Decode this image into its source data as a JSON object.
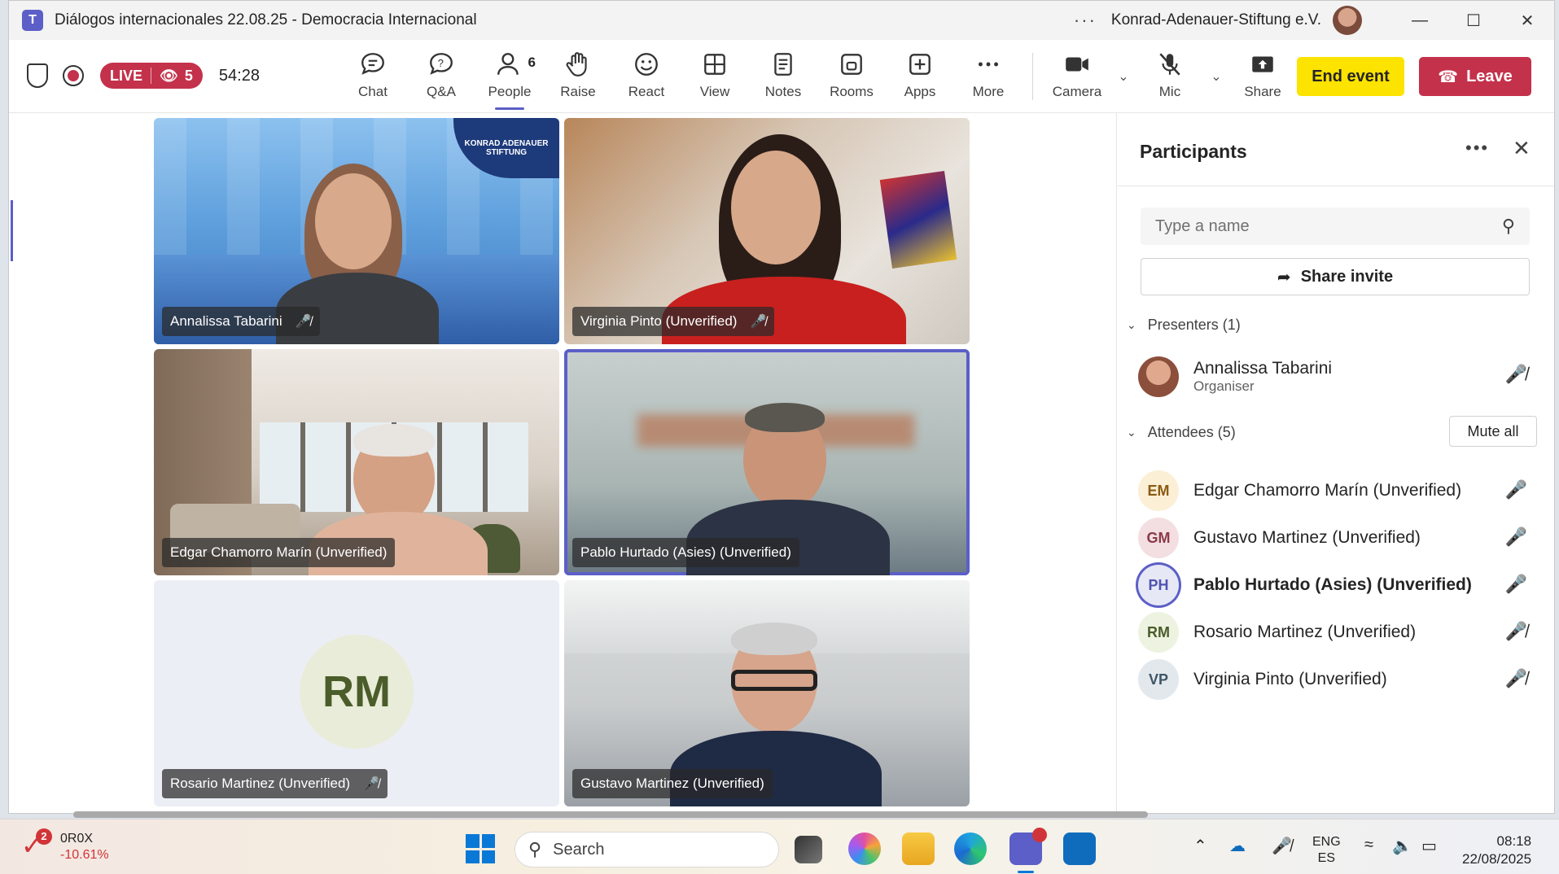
{
  "window": {
    "title": "Diálogos internacionales 22.08.25 - Democracia Internacional",
    "org": "Konrad-Adenauer-Stiftung e.V.",
    "more_label": "···"
  },
  "toolbar": {
    "live_label": "LIVE",
    "viewers": "5",
    "timer": "54:28",
    "tools": [
      {
        "key": "chat",
        "label": "Chat"
      },
      {
        "key": "qa",
        "label": "Q&A"
      },
      {
        "key": "people",
        "label": "People",
        "count": "6"
      },
      {
        "key": "raise",
        "label": "Raise"
      },
      {
        "key": "react",
        "label": "React"
      },
      {
        "key": "view",
        "label": "View"
      },
      {
        "key": "notes",
        "label": "Notes"
      },
      {
        "key": "rooms",
        "label": "Rooms"
      },
      {
        "key": "apps",
        "label": "Apps"
      },
      {
        "key": "more",
        "label": "More"
      }
    ],
    "camera_label": "Camera",
    "mic_label": "Mic",
    "share_label": "Share",
    "end_event_label": "End event",
    "leave_label": "Leave"
  },
  "video_tiles": [
    {
      "name": "Annalissa Tabarini",
      "muted": true
    },
    {
      "name": "Virginia Pinto (Unverified)",
      "muted": true
    },
    {
      "name": "Edgar Chamorro Marín (Unverified)",
      "muted": false
    },
    {
      "name": "Pablo Hurtado (Asies) (Unverified)",
      "muted": false,
      "speaking": true
    },
    {
      "name": "Rosario Martinez (Unverified)",
      "muted": true,
      "initials": "RM"
    },
    {
      "name": "Gustavo Martinez (Unverified)",
      "muted": false
    }
  ],
  "kas_logo": "KONRAD ADENAUER STIFTUNG",
  "panel": {
    "title": "Participants",
    "search_placeholder": "Type a name",
    "share_invite_label": "Share invite",
    "presenters_label": "Presenters (1)",
    "attendees_label": "Attendees (5)",
    "mute_all_label": "Mute all",
    "presenter": {
      "name": "Annalissa Tabarini",
      "role": "Organiser",
      "muted": true
    },
    "attendees": [
      {
        "initials": "EM",
        "name": "Edgar Chamorro Marín (Unverified)",
        "muted": false,
        "avatar_bg": "#fbefd6",
        "avatar_fg": "#8a5b12"
      },
      {
        "initials": "GM",
        "name": "Gustavo Martinez (Unverified)",
        "muted": false,
        "avatar_bg": "#f3dfe2",
        "avatar_fg": "#8a3a48"
      },
      {
        "initials": "PH",
        "name": "Pablo Hurtado (Asies) (Unverified)",
        "muted": false,
        "speaking": true,
        "avatar_bg": "#e6e8f5",
        "avatar_fg": "#4f52b2"
      },
      {
        "initials": "RM",
        "name": "Rosario Martinez (Unverified)",
        "muted": true,
        "avatar_bg": "#eef2e0",
        "avatar_fg": "#4a5d2a"
      },
      {
        "initials": "VP",
        "name": "Virginia Pinto (Unverified)",
        "muted": true,
        "avatar_bg": "#e3e8ed",
        "avatar_fg": "#3d5566"
      }
    ]
  },
  "taskbar": {
    "stock_badge": "2",
    "stock_symbol": "0R0X",
    "stock_change": "-10.61%",
    "search_label": "Search",
    "lang_top": "ENG",
    "lang_bottom": "ES",
    "time": "08:18",
    "date": "22/08/2025"
  },
  "colors": {
    "accent": "#5b5fc7",
    "live_red": "#c4314b",
    "end_event_yellow": "#fde300"
  }
}
